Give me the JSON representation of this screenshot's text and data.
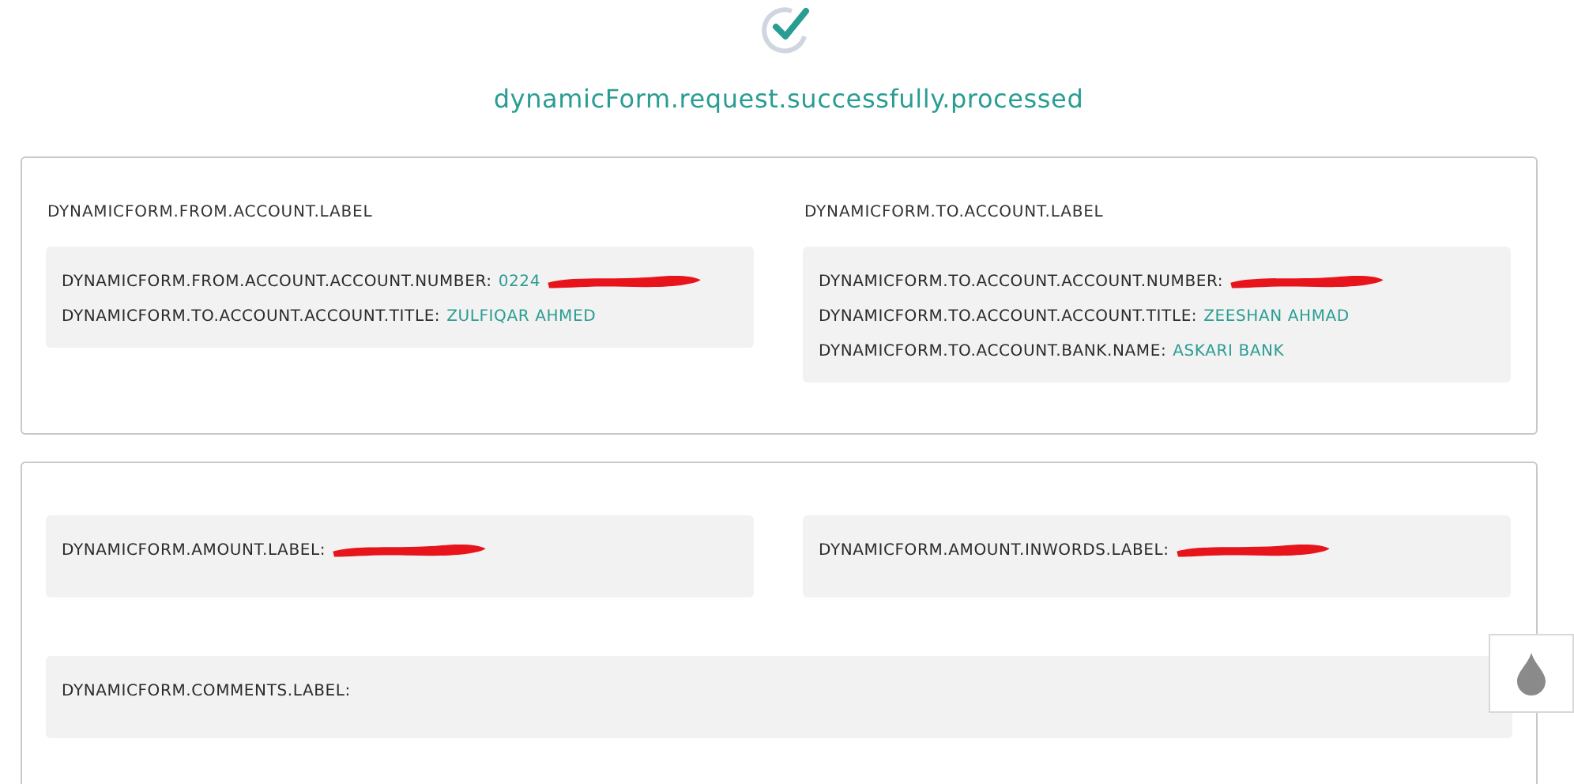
{
  "header": {
    "title": "dynamicForm.request.successfully.processed"
  },
  "cards": [
    {
      "columns": [
        {
          "heading": "DYNAMICFORM.FROM.ACCOUNT.LABEL",
          "fields": [
            {
              "label": "DYNAMICFORM.FROM.ACCOUNT.ACCOUNT.NUMBER:",
              "value": "0224",
              "redacted": true
            },
            {
              "label": "DYNAMICFORM.TO.ACCOUNT.ACCOUNT.TITLE:",
              "value": "ZULFIQAR AHMED",
              "redacted": false
            }
          ]
        },
        {
          "heading": "DYNAMICFORM.TO.ACCOUNT.LABEL",
          "fields": [
            {
              "label": "DYNAMICFORM.TO.ACCOUNT.ACCOUNT.NUMBER:",
              "redacted": true
            },
            {
              "label": "DYNAMICFORM.TO.ACCOUNT.ACCOUNT.TITLE:",
              "value": "ZEESHAN AHMAD",
              "redacted": false
            },
            {
              "label": "DYNAMICFORM.TO.ACCOUNT.BANK.NAME:",
              "value": "ASKARI BANK",
              "redacted": false
            }
          ]
        }
      ]
    },
    {
      "columns": [
        {
          "fields": [
            {
              "label": "DYNAMICFORM.AMOUNT.LABEL:",
              "redacted": true
            }
          ]
        },
        {
          "fields": [
            {
              "label": "DYNAMICFORM.AMOUNT.INWORDS.LABEL:",
              "redacted": true
            }
          ]
        }
      ],
      "full": {
        "fields": [
          {
            "label": "DYNAMICFORM.COMMENTS.LABEL:",
            "redacted": false
          }
        ]
      }
    }
  ]
}
